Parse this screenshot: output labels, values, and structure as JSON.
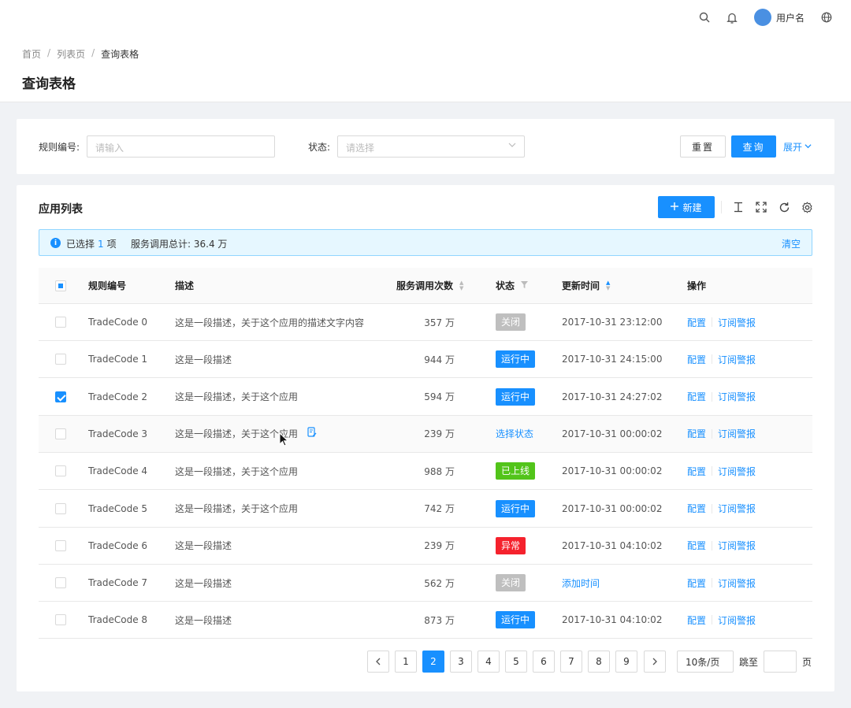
{
  "topbar": {
    "username": "用户名",
    "icons": [
      "search-icon",
      "bell-icon",
      "avatar",
      "globe-icon"
    ]
  },
  "breadcrumb": [
    "首页",
    "列表页",
    "查询表格"
  ],
  "page_title": "查询表格",
  "search": {
    "rule_label": "规则编号:",
    "rule_placeholder": "请输入",
    "status_label": "状态:",
    "status_placeholder": "请选择",
    "reset": "重置",
    "query": "查询",
    "expand": "展开"
  },
  "table": {
    "title": "应用列表",
    "new_button": "新建",
    "alert": {
      "selected_prefix": "已选择",
      "selected_count": "1",
      "selected_suffix": "项",
      "total": "服务调用总计: 36.4 万",
      "clear": "清空"
    },
    "columns": [
      "规则编号",
      "描述",
      "服务调用次数",
      "状态",
      "更新时间",
      "操作"
    ],
    "rows": [
      {
        "code": "TradeCode 0",
        "desc": "这是一段描述，关于这个应用的描述文字内容",
        "calls": "357 万",
        "status": "关闭",
        "status_type": "closed",
        "time": "2017-10-31  23:12:00",
        "op1": "配置",
        "op2": "订阅警报",
        "checked": false
      },
      {
        "code": "TradeCode 1",
        "desc": "这是一段描述",
        "calls": "944 万",
        "status": "运行中",
        "status_type": "running",
        "time": "2017-10-31  24:15:00",
        "op1": "配置",
        "op2": "订阅警报",
        "checked": false
      },
      {
        "code": "TradeCode 2",
        "desc": "这是一段描述，关于这个应用",
        "calls": "594 万",
        "status": "运行中",
        "status_type": "running",
        "time": "2017-10-31  24:27:02",
        "op1": "配置",
        "op2": "订阅警报",
        "checked": true
      },
      {
        "code": "TradeCode 3",
        "desc": "这是一段描述，关于这个应用",
        "calls": "239 万",
        "status": "选择状态",
        "status_type": "link",
        "time": "2017-10-31  00:00:02",
        "op1": "配置",
        "op2": "订阅警报",
        "checked": false
      },
      {
        "code": "TradeCode 4",
        "desc": "这是一段描述，关于这个应用",
        "calls": "988 万",
        "status": "已上线",
        "status_type": "online",
        "time": "2017-10-31  00:00:02",
        "op1": "配置",
        "op2": "订阅警报",
        "checked": false
      },
      {
        "code": "TradeCode 5",
        "desc": "这是一段描述，关于这个应用",
        "calls": "742 万",
        "status": "运行中",
        "status_type": "running",
        "time": "2017-10-31  00:00:02",
        "op1": "配置",
        "op2": "订阅警报",
        "checked": false
      },
      {
        "code": "TradeCode 6",
        "desc": "这是一段描述",
        "calls": "239 万",
        "status": "异常",
        "status_type": "error",
        "time": "2017-10-31  04:10:02",
        "op1": "配置",
        "op2": "订阅警报",
        "checked": false
      },
      {
        "code": "TradeCode 7",
        "desc": "这是一段描述",
        "calls": "562 万",
        "status": "关闭",
        "status_type": "closed",
        "time": "添加时间",
        "time_is_link": true,
        "op1": "配置",
        "op2": "订阅警报",
        "checked": false
      },
      {
        "code": "TradeCode 8",
        "desc": "这是一段描述",
        "calls": "873 万",
        "status": "运行中",
        "status_type": "running",
        "time": "2017-10-31  04:10:02",
        "op1": "配置",
        "op2": "订阅警报",
        "checked": false
      }
    ]
  },
  "pagination": {
    "pages": [
      "1",
      "2",
      "3",
      "4",
      "5",
      "6",
      "7",
      "8",
      "9"
    ],
    "current": "2",
    "page_size": "10条/页",
    "jump_label": "跳至",
    "page_suffix": "页"
  },
  "colors": {
    "primary": "#1890ff",
    "closed": "#bfbfbf",
    "running": "#1890ff",
    "online": "#52c41a",
    "error": "#f5222d"
  }
}
